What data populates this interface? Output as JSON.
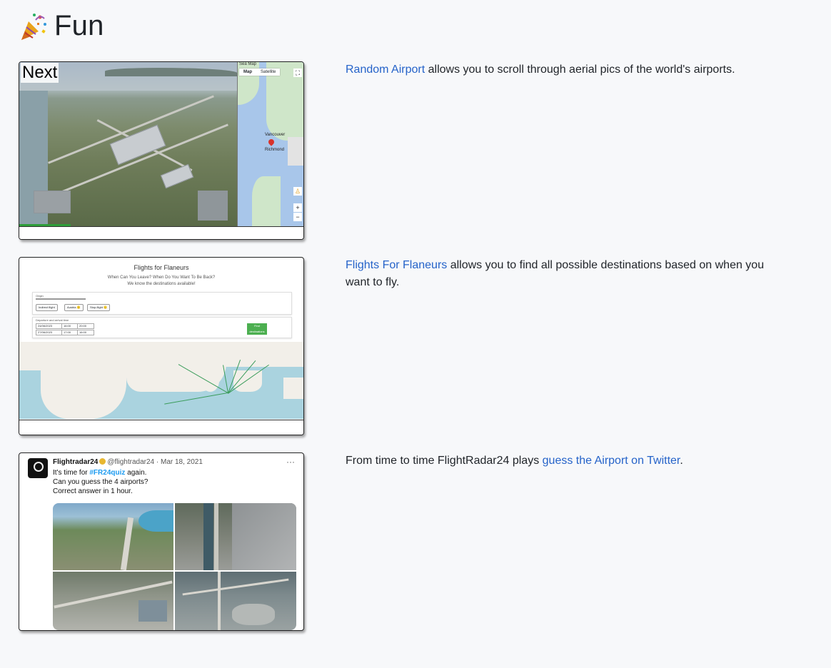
{
  "section": {
    "title": "Fun",
    "icon": "party-popper-icon"
  },
  "items": [
    {
      "link_text": "Random Airport",
      "after_text": " allows you to scroll through aerial pics of the world's airports.",
      "preview": {
        "next_label": "Next",
        "map_header": "Sea Map",
        "map_tab_map": "Map",
        "map_tab_satellite": "Satellite",
        "map_city": "Vancouver",
        "map_place": "Richmond"
      }
    },
    {
      "link_text": "Flights For Flaneurs",
      "after_text": " allows you to find all possible destinations based on when you want to fly.",
      "preview": {
        "title": "Flights for Flaneurs",
        "subtitle1": "When Can You Leave? When Do You Want To Be Back?",
        "subtitle2": "We know the destinations available!",
        "origin_label": "Origin",
        "chips": [
          "Indirect flight",
          "Austria 🙂",
          "Stop-flight 🙂"
        ],
        "departure_label": "Departure and arrival time",
        "date1": "24/06/2023",
        "date2": "27/06/2023",
        "time1": "16:00",
        "time2": "20:00",
        "time3": "17:00",
        "time4": "16:00",
        "go_label": "Find destinations"
      }
    },
    {
      "before_text": "From time to time FlightRadar24 plays ",
      "link_text": "guess the Airport on Twitter",
      "after_text": ".",
      "preview": {
        "name": "Flightradar24",
        "handle": "@flightradar24 · Mar 18, 2021",
        "line1_prefix": "It's time for ",
        "hashtag": "#FR24quiz",
        "line1_suffix": " again.",
        "line2": "Can you guess the 4 airports?",
        "line3": "Correct answer in 1 hour.",
        "more": "···"
      }
    }
  ]
}
